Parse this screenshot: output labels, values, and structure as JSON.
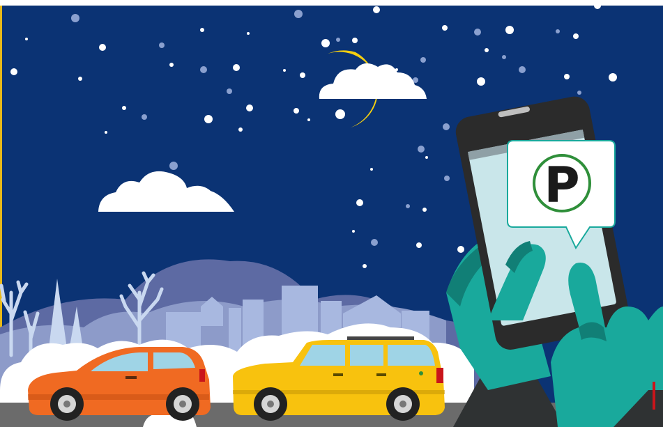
{
  "illustration": {
    "subject": "night-winter-street-with-phone-parking-app",
    "parking_symbol": "P",
    "colors": {
      "sky": "#0b3374",
      "moon": "#f6cf0f",
      "cloud": "#ffffff",
      "snow": "#ffffff",
      "far_hills": "#5d6aa3",
      "mid_hills": "#8d9bc9",
      "skyline": "#a8b8e0",
      "trees": "#c9d8f0",
      "road": "#6b6b6b",
      "orange_car": "#f06a22",
      "yellow_car": "#f8c20e",
      "hand": "#19a99c",
      "hand_shadow": "#117f76",
      "phone_body": "#2b2b2b",
      "phone_screen": "#c9e6ea",
      "bubble": "#ffffff",
      "bubble_border": "#19a99c",
      "parking_ring": "#2f8f3a",
      "sleeve": "#2f3233",
      "left_edge_line": "#e9b918"
    },
    "icons": [
      "moon-icon",
      "cloud-icon",
      "parking-sign-icon",
      "smartphone-icon",
      "car-icon"
    ]
  }
}
